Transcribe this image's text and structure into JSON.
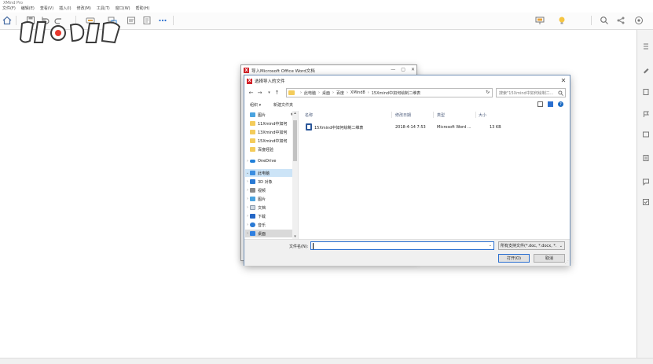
{
  "app": {
    "title": "XMind Pro",
    "menus": [
      "文件(F)",
      "编辑(E)",
      "查看(V)",
      "插入(I)",
      "修改(M)",
      "工具(T)",
      "窗口(W)",
      "帮助(H)"
    ]
  },
  "colors": {
    "accent": "#2a6fd0",
    "xmind_red": "#d2232a",
    "folder": "#f4cc5b"
  },
  "icons": {
    "toolbar": [
      "home-icon",
      "save-icon",
      "undo-icon",
      "redo-icon",
      "topic-icon",
      "subtopic-icon",
      "relationship-icon",
      "boundary-icon",
      "more-icon",
      "presentation-icon",
      "idea-icon",
      "search-icon",
      "share-icon",
      "help-icon"
    ],
    "right_panel": [
      "properties-icon",
      "marker-icon",
      "flag-icon",
      "notes-icon",
      "comment-icon",
      "task-icon"
    ]
  },
  "back_dialog": {
    "title": "导入Microsoft Office Word文档"
  },
  "dialog": {
    "title": "选择导入的文件",
    "close": "✕",
    "breadcrumbs": [
      "此电脑",
      "桌面",
      "百度",
      "XMind8",
      "15Xmind中如何绘制二维表"
    ],
    "search_placeholder": "搜索\"15Xmind中如何绘制二...",
    "commands": {
      "organize": "组织 ▾",
      "new_folder": "新建文件夹"
    },
    "nav_items": [
      {
        "label": "图片",
        "icon": "picture-icon",
        "pinned": true
      },
      {
        "label": "11Xmind中如何",
        "icon": "folder-icon"
      },
      {
        "label": "13Xmind中如何",
        "icon": "folder-icon"
      },
      {
        "label": "15Xmind中如何",
        "icon": "folder-icon"
      },
      {
        "label": "百度经验",
        "icon": "folder-icon"
      },
      {
        "label": "OneDrive",
        "icon": "cloud-icon"
      },
      {
        "label": "此电脑",
        "icon": "computer-icon"
      },
      {
        "label": "3D 对象",
        "icon": "cube-icon"
      },
      {
        "label": "视频",
        "icon": "video-icon"
      },
      {
        "label": "图片",
        "icon": "picture-icon"
      },
      {
        "label": "文档",
        "icon": "document-icon"
      },
      {
        "label": "下载",
        "icon": "download-icon"
      },
      {
        "label": "音乐",
        "icon": "music-icon"
      },
      {
        "label": "桌面",
        "icon": "desktop-icon"
      }
    ],
    "columns": [
      "名称",
      "修改日期",
      "类型",
      "大小"
    ],
    "files": [
      {
        "name": "15Xmind中如何绘制二维表",
        "modified": "2018-4-14 7:53",
        "type": "Microsoft Word ...",
        "size": "13 KB"
      }
    ],
    "filename_label": "文件名(N):",
    "filename_value": "",
    "filetype_value": "所有支持文件(*.doc, *.docx, *.",
    "open_label": "打开(O)",
    "cancel_label": "取消"
  }
}
